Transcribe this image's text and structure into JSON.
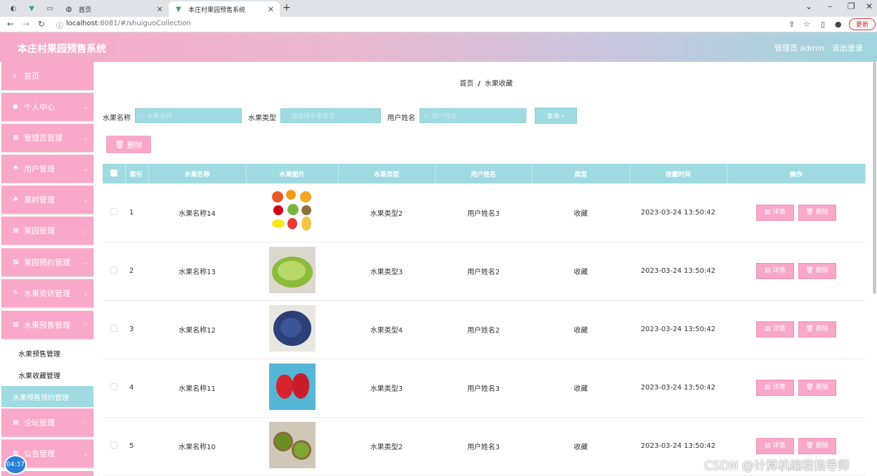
{
  "browser": {
    "tabs": [
      {
        "label": "首页",
        "active": false
      },
      {
        "label": "本庄村果园预售系统",
        "active": true
      }
    ],
    "url_host": "localhost",
    "url_rest": ":8081/#/shuiguoCollection",
    "update_label": "更新"
  },
  "header": {
    "title": "本庄村果园预售系统",
    "user_label": "管理员 admin",
    "logout_label": "退出登录"
  },
  "sidebar": {
    "items": [
      {
        "label": "首页",
        "icon": "home-icon"
      },
      {
        "label": "个人中心",
        "icon": "user-icon"
      },
      {
        "label": "管理员管理",
        "icon": "grid-icon"
      },
      {
        "label": "用户管理",
        "icon": "flag-icon"
      },
      {
        "label": "果树管理",
        "icon": "tree-icon"
      },
      {
        "label": "果园管理",
        "icon": "grid-icon"
      },
      {
        "label": "果园预约管理",
        "icon": "grid-icon"
      },
      {
        "label": "水果资讯管理",
        "icon": "pen-icon"
      },
      {
        "label": "水果预售管理",
        "icon": "grid-icon"
      }
    ],
    "sub_items": [
      "水果预售管理",
      "水果收藏管理"
    ],
    "hover_item": "水果预售预约管理",
    "bottom_items": [
      {
        "label": "论坛管理",
        "icon": "grid-icon"
      },
      {
        "label": "公告管理",
        "icon": "grid-icon"
      }
    ]
  },
  "breadcrumb": {
    "home": "首页",
    "sep": "/",
    "current": "水果收藏"
  },
  "search": {
    "fruit_name_label": "水果名称",
    "fruit_name_placeholder": "水果名称",
    "fruit_type_label": "水果类型",
    "fruit_type_placeholder": "请选择水果类型",
    "user_name_label": "用户姓名",
    "user_name_placeholder": "用户姓名",
    "query_label": "查询"
  },
  "delete_label": "删除",
  "table": {
    "headers": [
      "索引",
      "水果名称",
      "水果图片",
      "水果类型",
      "用户姓名",
      "类型",
      "收藏时间",
      "操作"
    ],
    "detail_label": "详情",
    "delete_label": "删除",
    "rows": [
      {
        "index": "1",
        "name": "水果名称14",
        "type": "水果类型2",
        "user": "用户姓名3",
        "kind": "收藏",
        "time": "2023-03-24 13:50:42"
      },
      {
        "index": "2",
        "name": "水果名称13",
        "type": "水果类型3",
        "user": "用户姓名2",
        "kind": "收藏",
        "time": "2023-03-24 13:50:42"
      },
      {
        "index": "3",
        "name": "水果名称12",
        "type": "水果类型4",
        "user": "用户姓名2",
        "kind": "收藏",
        "time": "2023-03-24 13:50:42"
      },
      {
        "index": "4",
        "name": "水果名称11",
        "type": "水果类型3",
        "user": "用户姓名3",
        "kind": "收藏",
        "time": "2023-03-24 13:50:42"
      },
      {
        "index": "5",
        "name": "水果名称10",
        "type": "水果类型2",
        "user": "用户姓名3",
        "kind": "收藏",
        "time": "2023-03-24 13:50:42"
      }
    ]
  },
  "overlay": {
    "clock": "04:37",
    "watermark": "CSDN @计算机编程指导师"
  },
  "colors": {
    "accent_pink": "#f9a8c9",
    "accent_cyan": "#9fdbe0"
  }
}
